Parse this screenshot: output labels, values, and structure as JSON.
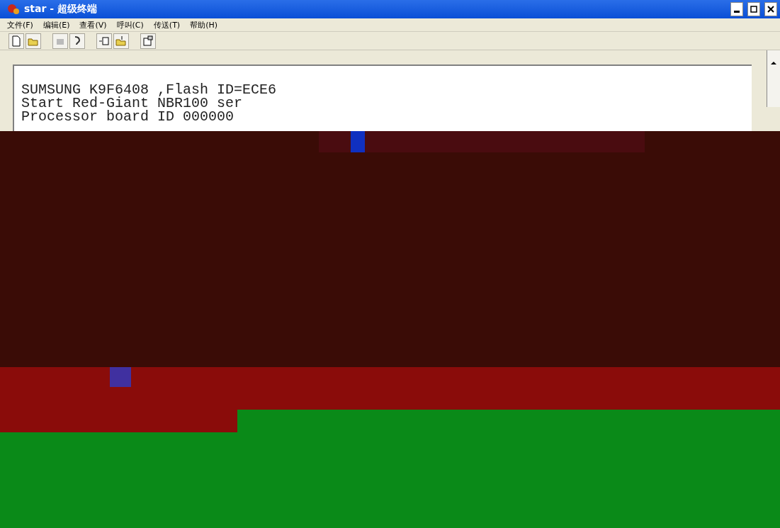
{
  "window": {
    "title": "star - 超级终端"
  },
  "menu": [
    {
      "label": "文件(F)"
    },
    {
      "label": "编辑(E)"
    },
    {
      "label": "查看(V)"
    },
    {
      "label": "呼叫(C)"
    },
    {
      "label": "传送(T)"
    },
    {
      "label": "帮助(H)"
    }
  ],
  "terminal": {
    "lines": [
      "SUMSUNG K9F6408 ,Flash ID=ECE6",
      "Start Red-Giant NBR100 ser",
      "Processor board ID 000000"
    ]
  }
}
